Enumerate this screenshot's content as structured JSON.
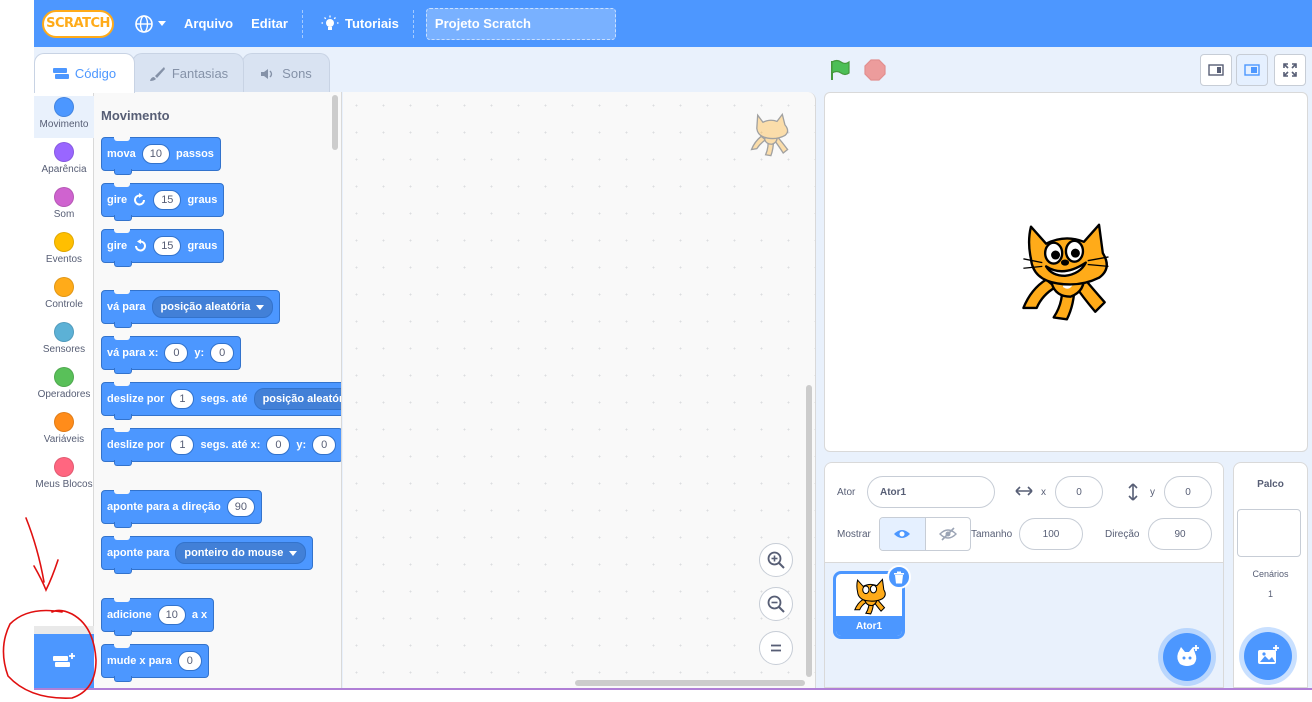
{
  "menubar": {
    "logo": "SCRATCH",
    "items": [
      "Arquivo",
      "Editar"
    ],
    "tutorials": "Tutoriais",
    "project_title": "Projeto Scratch"
  },
  "tabs": {
    "code": "Código",
    "costumes": "Fantasias",
    "sounds": "Sons"
  },
  "categories": [
    {
      "label": "Movimento",
      "color": "#4c97ff"
    },
    {
      "label": "Aparência",
      "color": "#9966ff"
    },
    {
      "label": "Som",
      "color": "#cf63cf"
    },
    {
      "label": "Eventos",
      "color": "#ffbf00"
    },
    {
      "label": "Controle",
      "color": "#ffab19"
    },
    {
      "label": "Sensores",
      "color": "#5cb1d6"
    },
    {
      "label": "Operadores",
      "color": "#59c059"
    },
    {
      "label": "Variáveis",
      "color": "#ff8c1a"
    },
    {
      "label": "Meus Blocos",
      "color": "#ff6680"
    }
  ],
  "palette": {
    "title": "Movimento",
    "blocks": {
      "move": {
        "a": "mova",
        "v": "10",
        "b": "passos"
      },
      "turn_right": {
        "a": "gire",
        "v": "15",
        "b": "graus"
      },
      "turn_left": {
        "a": "gire",
        "v": "15",
        "b": "graus"
      },
      "goto": {
        "a": "vá para",
        "menu": "posição aleatória"
      },
      "goto_xy": {
        "a": "vá para x:",
        "x": "0",
        "y_label": "y:",
        "y": "0"
      },
      "glide_to": {
        "a": "deslize por",
        "v": "1",
        "b": "segs. até",
        "menu": "posição aleatória"
      },
      "glide_xy": {
        "a": "deslize por",
        "v": "1",
        "b": "segs. até x:",
        "x": "0",
        "y_label": "y:",
        "y": "0"
      },
      "point_dir": {
        "a": "aponte para a direção",
        "v": "90"
      },
      "point_towards": {
        "a": "aponte para",
        "menu": "ponteiro do mouse"
      },
      "change_x": {
        "a": "adicione",
        "v": "10",
        "b": "a x"
      },
      "set_x": {
        "a": "mude x para",
        "v": "0"
      }
    }
  },
  "sprite_info": {
    "sprite_label": "Ator",
    "sprite_name": "Ator1",
    "x_label": "x",
    "x": "0",
    "y_label": "y",
    "y": "0",
    "show_label": "Mostrar",
    "size_label": "Tamanho",
    "size": "100",
    "direction_label": "Direção",
    "direction": "90"
  },
  "sprite_list": [
    {
      "name": "Ator1"
    }
  ],
  "stage_pane": {
    "title": "Palco",
    "backdrops_label": "Cenários",
    "backdrops_count": "1"
  }
}
